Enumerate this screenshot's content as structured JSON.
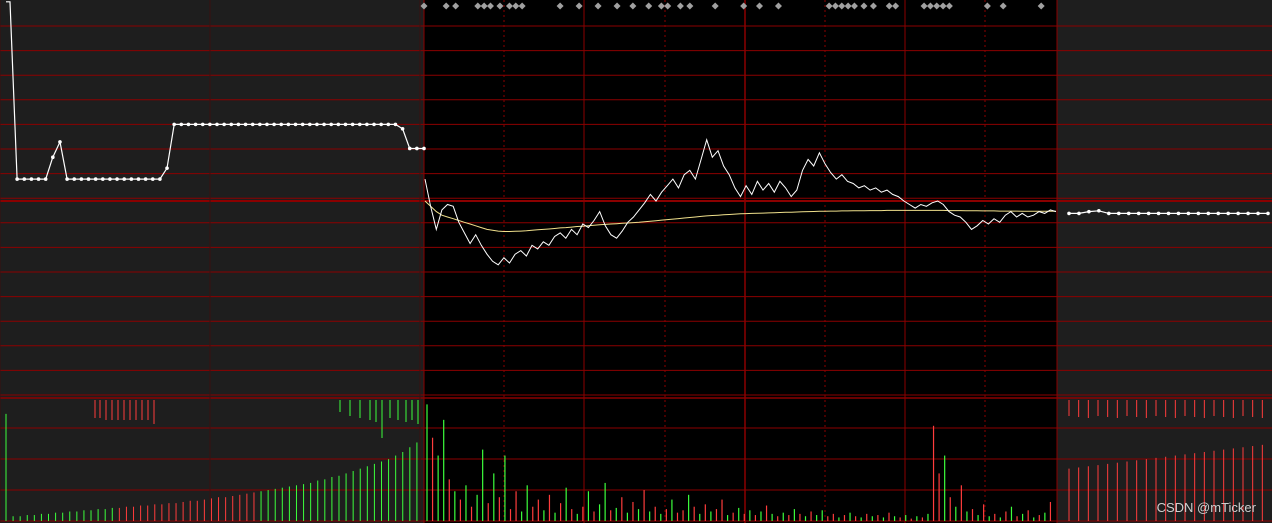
{
  "chart_data": {
    "type": "line",
    "title": "",
    "xlabel": "",
    "ylabel": "",
    "grid": true,
    "legend": "none",
    "colors": {
      "background_trading": "#000000",
      "background_extended": "#1e1e1e",
      "grid": "#8b0000",
      "price_line": "#ffffff",
      "avg_line": "#f0e08c",
      "volume_up": "#ff3c3c",
      "volume_down": "#3cff3c",
      "marker": "#a0a0a0"
    },
    "price_ylim": [
      -11,
      9
    ],
    "base_level": 0,
    "volume_ylim": [
      0,
      100
    ],
    "pre_market_price": [
      9.1,
      1.0,
      1.0,
      1.0,
      1.0,
      1.0,
      2.0,
      2.7,
      1.0,
      1.0,
      1.0,
      1.0,
      1.0,
      1.0,
      1.0,
      1.0,
      1.0,
      1.0,
      1.0,
      1.0,
      1.0,
      1.0,
      1.5,
      3.5,
      3.5,
      3.5,
      3.5,
      3.5,
      3.5,
      3.5,
      3.5,
      3.5,
      3.5,
      3.5,
      3.5,
      3.5,
      3.5,
      3.5,
      3.5,
      3.5,
      3.5,
      3.5,
      3.5,
      3.5,
      3.5,
      3.5,
      3.5,
      3.5,
      3.5,
      3.5,
      3.5,
      3.5,
      3.5,
      3.5,
      3.5,
      3.3,
      2.4,
      2.4,
      2.4
    ],
    "intraday_price": [
      1.0,
      -0.3,
      -1.6,
      -0.5,
      -0.2,
      -0.3,
      -1.2,
      -1.8,
      -2.4,
      -1.9,
      -2.5,
      -3.0,
      -3.4,
      -3.6,
      -3.2,
      -3.5,
      -3.0,
      -2.8,
      -3.1,
      -2.5,
      -2.7,
      -2.3,
      -2.5,
      -2.0,
      -1.8,
      -2.1,
      -1.6,
      -1.9,
      -1.3,
      -1.5,
      -1.1,
      -0.6,
      -1.4,
      -1.9,
      -2.1,
      -1.7,
      -1.2,
      -0.9,
      -0.5,
      -0.1,
      0.3,
      0.0,
      0.4,
      0.7,
      1.0,
      0.6,
      1.2,
      1.4,
      1.0,
      1.9,
      2.8,
      2.0,
      2.3,
      1.6,
      1.2,
      0.6,
      0.2,
      0.7,
      0.3,
      0.9,
      0.5,
      0.8,
      0.4,
      0.9,
      0.6,
      0.2,
      0.5,
      1.4,
      1.9,
      1.6,
      2.2,
      1.7,
      1.3,
      1.0,
      1.2,
      0.9,
      0.8,
      0.6,
      0.7,
      0.5,
      0.6,
      0.4,
      0.5,
      0.3,
      0.2,
      0.0,
      -0.2,
      -0.4,
      -0.2,
      -0.3,
      -0.1,
      0.0,
      -0.2,
      -0.6,
      -0.8,
      -0.9,
      -1.2,
      -1.6,
      -1.4,
      -1.1,
      -1.3,
      -1.0,
      -1.2,
      -0.8,
      -0.6,
      -0.9,
      -0.7,
      -0.9,
      -0.8,
      -0.6,
      -0.7,
      -0.5,
      -0.6
    ],
    "intraday_avg": [
      0.0,
      -0.3,
      -0.6,
      -0.8,
      -0.9,
      -1.0,
      -1.1,
      -1.2,
      -1.3,
      -1.4,
      -1.5,
      -1.6,
      -1.65,
      -1.7,
      -1.72,
      -1.72,
      -1.71,
      -1.7,
      -1.68,
      -1.65,
      -1.62,
      -1.6,
      -1.58,
      -1.55,
      -1.52,
      -1.5,
      -1.47,
      -1.44,
      -1.42,
      -1.4,
      -1.37,
      -1.34,
      -1.32,
      -1.3,
      -1.28,
      -1.26,
      -1.24,
      -1.22,
      -1.2,
      -1.17,
      -1.14,
      -1.11,
      -1.08,
      -1.05,
      -1.02,
      -0.99,
      -0.96,
      -0.93,
      -0.9,
      -0.87,
      -0.84,
      -0.82,
      -0.8,
      -0.78,
      -0.76,
      -0.74,
      -0.72,
      -0.71,
      -0.7,
      -0.69,
      -0.68,
      -0.67,
      -0.66,
      -0.65,
      -0.64,
      -0.63,
      -0.62,
      -0.61,
      -0.6,
      -0.59,
      -0.58,
      -0.58,
      -0.57,
      -0.57,
      -0.56,
      -0.56,
      -0.55,
      -0.55,
      -0.55,
      -0.54,
      -0.54,
      -0.54,
      -0.53,
      -0.53,
      -0.53,
      -0.53,
      -0.53,
      -0.53,
      -0.53,
      -0.53,
      -0.53,
      -0.53,
      -0.53,
      -0.54,
      -0.54,
      -0.54,
      -0.55,
      -0.55,
      -0.55,
      -0.56,
      -0.56,
      -0.56,
      -0.57,
      -0.57,
      -0.57,
      -0.57,
      -0.58,
      -0.58,
      -0.58,
      -0.58,
      -0.58,
      -0.58,
      -0.58
    ],
    "post_market_price": [
      -0.7,
      -0.7,
      -0.6,
      -0.55,
      -0.7,
      -0.7,
      -0.7,
      -0.7,
      -0.7,
      -0.7,
      -0.7,
      -0.7,
      -0.7,
      -0.7,
      -0.7,
      -0.7,
      -0.7,
      -0.7,
      -0.7,
      -0.7,
      -0.7
    ],
    "pre_market_volume": [
      {
        "v": 90,
        "d": "down"
      },
      {
        "v": 4,
        "d": "down"
      },
      {
        "v": 4,
        "d": "down"
      },
      {
        "v": 5,
        "d": "down"
      },
      {
        "v": 5,
        "d": "down"
      },
      {
        "v": 6,
        "d": "down"
      },
      {
        "v": 6,
        "d": "down"
      },
      {
        "v": 7,
        "d": "down"
      },
      {
        "v": 7,
        "d": "down"
      },
      {
        "v": 8,
        "d": "down"
      },
      {
        "v": 8,
        "d": "down"
      },
      {
        "v": 9,
        "d": "down"
      },
      {
        "v": 9,
        "d": "down"
      },
      {
        "v": 10,
        "d": "down"
      },
      {
        "v": 10,
        "d": "down"
      },
      {
        "v": 11,
        "d": "down"
      },
      {
        "v": 11,
        "d": "up"
      },
      {
        "v": 12,
        "d": "up"
      },
      {
        "v": 12,
        "d": "up"
      },
      {
        "v": 13,
        "d": "up"
      },
      {
        "v": 13,
        "d": "up"
      },
      {
        "v": 14,
        "d": "up"
      },
      {
        "v": 14,
        "d": "up"
      },
      {
        "v": 15,
        "d": "up"
      },
      {
        "v": 15,
        "d": "up"
      },
      {
        "v": 16,
        "d": "up"
      },
      {
        "v": 17,
        "d": "up"
      },
      {
        "v": 17,
        "d": "up"
      },
      {
        "v": 18,
        "d": "up"
      },
      {
        "v": 19,
        "d": "up"
      },
      {
        "v": 20,
        "d": "up"
      },
      {
        "v": 20,
        "d": "up"
      },
      {
        "v": 21,
        "d": "up"
      },
      {
        "v": 22,
        "d": "up"
      },
      {
        "v": 23,
        "d": "up"
      },
      {
        "v": 24,
        "d": "up"
      },
      {
        "v": 25,
        "d": "down"
      },
      {
        "v": 26,
        "d": "down"
      },
      {
        "v": 27,
        "d": "down"
      },
      {
        "v": 28,
        "d": "down"
      },
      {
        "v": 29,
        "d": "down"
      },
      {
        "v": 30,
        "d": "down"
      },
      {
        "v": 31,
        "d": "down"
      },
      {
        "v": 32,
        "d": "down"
      },
      {
        "v": 34,
        "d": "down"
      },
      {
        "v": 35,
        "d": "down"
      },
      {
        "v": 37,
        "d": "down"
      },
      {
        "v": 38,
        "d": "down"
      },
      {
        "v": 40,
        "d": "down"
      },
      {
        "v": 42,
        "d": "down"
      },
      {
        "v": 44,
        "d": "down"
      },
      {
        "v": 46,
        "d": "down"
      },
      {
        "v": 48,
        "d": "down"
      },
      {
        "v": 50,
        "d": "down"
      },
      {
        "v": 52,
        "d": "down"
      },
      {
        "v": 55,
        "d": "down"
      },
      {
        "v": 58,
        "d": "down"
      },
      {
        "v": 62,
        "d": "down"
      },
      {
        "v": 66,
        "d": "down"
      }
    ],
    "pre_market_volume_top": [
      0,
      0,
      0,
      0,
      0,
      0,
      0,
      0,
      0,
      0,
      0,
      0,
      0,
      0,
      0,
      0,
      0,
      0,
      0,
      0,
      0,
      0,
      0,
      0,
      0,
      0,
      0,
      0,
      0,
      0,
      0,
      0,
      0,
      0,
      0,
      0,
      0,
      0,
      0,
      0,
      0,
      0,
      0,
      0,
      0,
      0,
      0,
      0,
      0,
      0,
      0,
      0,
      0,
      0,
      0,
      0,
      0,
      0,
      0
    ],
    "post_market_volume": [
      {
        "v": 44,
        "d": "up"
      },
      {
        "v": 45,
        "d": "up"
      },
      {
        "v": 46,
        "d": "up"
      },
      {
        "v": 47,
        "d": "up"
      },
      {
        "v": 48,
        "d": "up"
      },
      {
        "v": 49,
        "d": "up"
      },
      {
        "v": 50,
        "d": "up"
      },
      {
        "v": 51,
        "d": "up"
      },
      {
        "v": 52,
        "d": "up"
      },
      {
        "v": 53,
        "d": "up"
      },
      {
        "v": 54,
        "d": "up"
      },
      {
        "v": 55,
        "d": "up"
      },
      {
        "v": 56,
        "d": "up"
      },
      {
        "v": 57,
        "d": "up"
      },
      {
        "v": 58,
        "d": "up"
      },
      {
        "v": 59,
        "d": "up"
      },
      {
        "v": 60,
        "d": "up"
      },
      {
        "v": 61,
        "d": "up"
      },
      {
        "v": 62,
        "d": "up"
      },
      {
        "v": 63,
        "d": "up"
      },
      {
        "v": 64,
        "d": "up"
      }
    ],
    "intraday_volume": [
      {
        "v": 98,
        "d": "down"
      },
      {
        "v": 70,
        "d": "up"
      },
      {
        "v": 55,
        "d": "down"
      },
      {
        "v": 85,
        "d": "down"
      },
      {
        "v": 35,
        "d": "up"
      },
      {
        "v": 25,
        "d": "down"
      },
      {
        "v": 18,
        "d": "up"
      },
      {
        "v": 30,
        "d": "down"
      },
      {
        "v": 12,
        "d": "up"
      },
      {
        "v": 22,
        "d": "down"
      },
      {
        "v": 60,
        "d": "down"
      },
      {
        "v": 15,
        "d": "up"
      },
      {
        "v": 40,
        "d": "down"
      },
      {
        "v": 20,
        "d": "up"
      },
      {
        "v": 55,
        "d": "down"
      },
      {
        "v": 10,
        "d": "up"
      },
      {
        "v": 25,
        "d": "up"
      },
      {
        "v": 8,
        "d": "down"
      },
      {
        "v": 30,
        "d": "down"
      },
      {
        "v": 12,
        "d": "up"
      },
      {
        "v": 18,
        "d": "up"
      },
      {
        "v": 9,
        "d": "down"
      },
      {
        "v": 22,
        "d": "up"
      },
      {
        "v": 7,
        "d": "down"
      },
      {
        "v": 15,
        "d": "up"
      },
      {
        "v": 28,
        "d": "down"
      },
      {
        "v": 10,
        "d": "up"
      },
      {
        "v": 6,
        "d": "down"
      },
      {
        "v": 12,
        "d": "up"
      },
      {
        "v": 25,
        "d": "down"
      },
      {
        "v": 8,
        "d": "up"
      },
      {
        "v": 14,
        "d": "down"
      },
      {
        "v": 32,
        "d": "down"
      },
      {
        "v": 9,
        "d": "up"
      },
      {
        "v": 11,
        "d": "down"
      },
      {
        "v": 20,
        "d": "up"
      },
      {
        "v": 7,
        "d": "down"
      },
      {
        "v": 16,
        "d": "up"
      },
      {
        "v": 10,
        "d": "down"
      },
      {
        "v": 26,
        "d": "up"
      },
      {
        "v": 8,
        "d": "down"
      },
      {
        "v": 12,
        "d": "up"
      },
      {
        "v": 6,
        "d": "down"
      },
      {
        "v": 10,
        "d": "up"
      },
      {
        "v": 18,
        "d": "down"
      },
      {
        "v": 7,
        "d": "up"
      },
      {
        "v": 9,
        "d": "up"
      },
      {
        "v": 22,
        "d": "down"
      },
      {
        "v": 12,
        "d": "up"
      },
      {
        "v": 6,
        "d": "down"
      },
      {
        "v": 14,
        "d": "up"
      },
      {
        "v": 8,
        "d": "down"
      },
      {
        "v": 10,
        "d": "up"
      },
      {
        "v": 18,
        "d": "up"
      },
      {
        "v": 5,
        "d": "down"
      },
      {
        "v": 7,
        "d": "up"
      },
      {
        "v": 11,
        "d": "down"
      },
      {
        "v": 6,
        "d": "up"
      },
      {
        "v": 9,
        "d": "down"
      },
      {
        "v": 5,
        "d": "up"
      },
      {
        "v": 8,
        "d": "down"
      },
      {
        "v": 13,
        "d": "up"
      },
      {
        "v": 6,
        "d": "down"
      },
      {
        "v": 4,
        "d": "up"
      },
      {
        "v": 7,
        "d": "down"
      },
      {
        "v": 5,
        "d": "up"
      },
      {
        "v": 10,
        "d": "down"
      },
      {
        "v": 6,
        "d": "up"
      },
      {
        "v": 4,
        "d": "down"
      },
      {
        "v": 8,
        "d": "up"
      },
      {
        "v": 5,
        "d": "down"
      },
      {
        "v": 9,
        "d": "down"
      },
      {
        "v": 4,
        "d": "up"
      },
      {
        "v": 6,
        "d": "up"
      },
      {
        "v": 3,
        "d": "down"
      },
      {
        "v": 5,
        "d": "up"
      },
      {
        "v": 7,
        "d": "down"
      },
      {
        "v": 4,
        "d": "up"
      },
      {
        "v": 3,
        "d": "down"
      },
      {
        "v": 6,
        "d": "up"
      },
      {
        "v": 4,
        "d": "down"
      },
      {
        "v": 5,
        "d": "up"
      },
      {
        "v": 3,
        "d": "down"
      },
      {
        "v": 7,
        "d": "up"
      },
      {
        "v": 4,
        "d": "down"
      },
      {
        "v": 3,
        "d": "up"
      },
      {
        "v": 5,
        "d": "down"
      },
      {
        "v": 2,
        "d": "up"
      },
      {
        "v": 4,
        "d": "down"
      },
      {
        "v": 3,
        "d": "up"
      },
      {
        "v": 6,
        "d": "down"
      },
      {
        "v": 80,
        "d": "up"
      },
      {
        "v": 40,
        "d": "up"
      },
      {
        "v": 55,
        "d": "down"
      },
      {
        "v": 20,
        "d": "up"
      },
      {
        "v": 12,
        "d": "down"
      },
      {
        "v": 30,
        "d": "up"
      },
      {
        "v": 8,
        "d": "down"
      },
      {
        "v": 10,
        "d": "up"
      },
      {
        "v": 5,
        "d": "down"
      },
      {
        "v": 14,
        "d": "up"
      },
      {
        "v": 4,
        "d": "down"
      },
      {
        "v": 6,
        "d": "up"
      },
      {
        "v": 3,
        "d": "down"
      },
      {
        "v": 8,
        "d": "up"
      },
      {
        "v": 12,
        "d": "down"
      },
      {
        "v": 4,
        "d": "up"
      },
      {
        "v": 6,
        "d": "down"
      },
      {
        "v": 9,
        "d": "up"
      },
      {
        "v": 3,
        "d": "down"
      },
      {
        "v": 5,
        "d": "up"
      },
      {
        "v": 7,
        "d": "down"
      },
      {
        "v": 16,
        "d": "up"
      }
    ],
    "markers": [
      0.0,
      0.035,
      0.05,
      0.085,
      0.095,
      0.105,
      0.12,
      0.135,
      0.145,
      0.155,
      0.215,
      0.245,
      0.275,
      0.305,
      0.33,
      0.355,
      0.375,
      0.385,
      0.405,
      0.42,
      0.46,
      0.505,
      0.53,
      0.56,
      0.64,
      0.65,
      0.66,
      0.67,
      0.68,
      0.695,
      0.71,
      0.735,
      0.745,
      0.79,
      0.8,
      0.81,
      0.82,
      0.83,
      0.89,
      0.915,
      0.975
    ],
    "watermark": "CSDN @mTicker"
  }
}
